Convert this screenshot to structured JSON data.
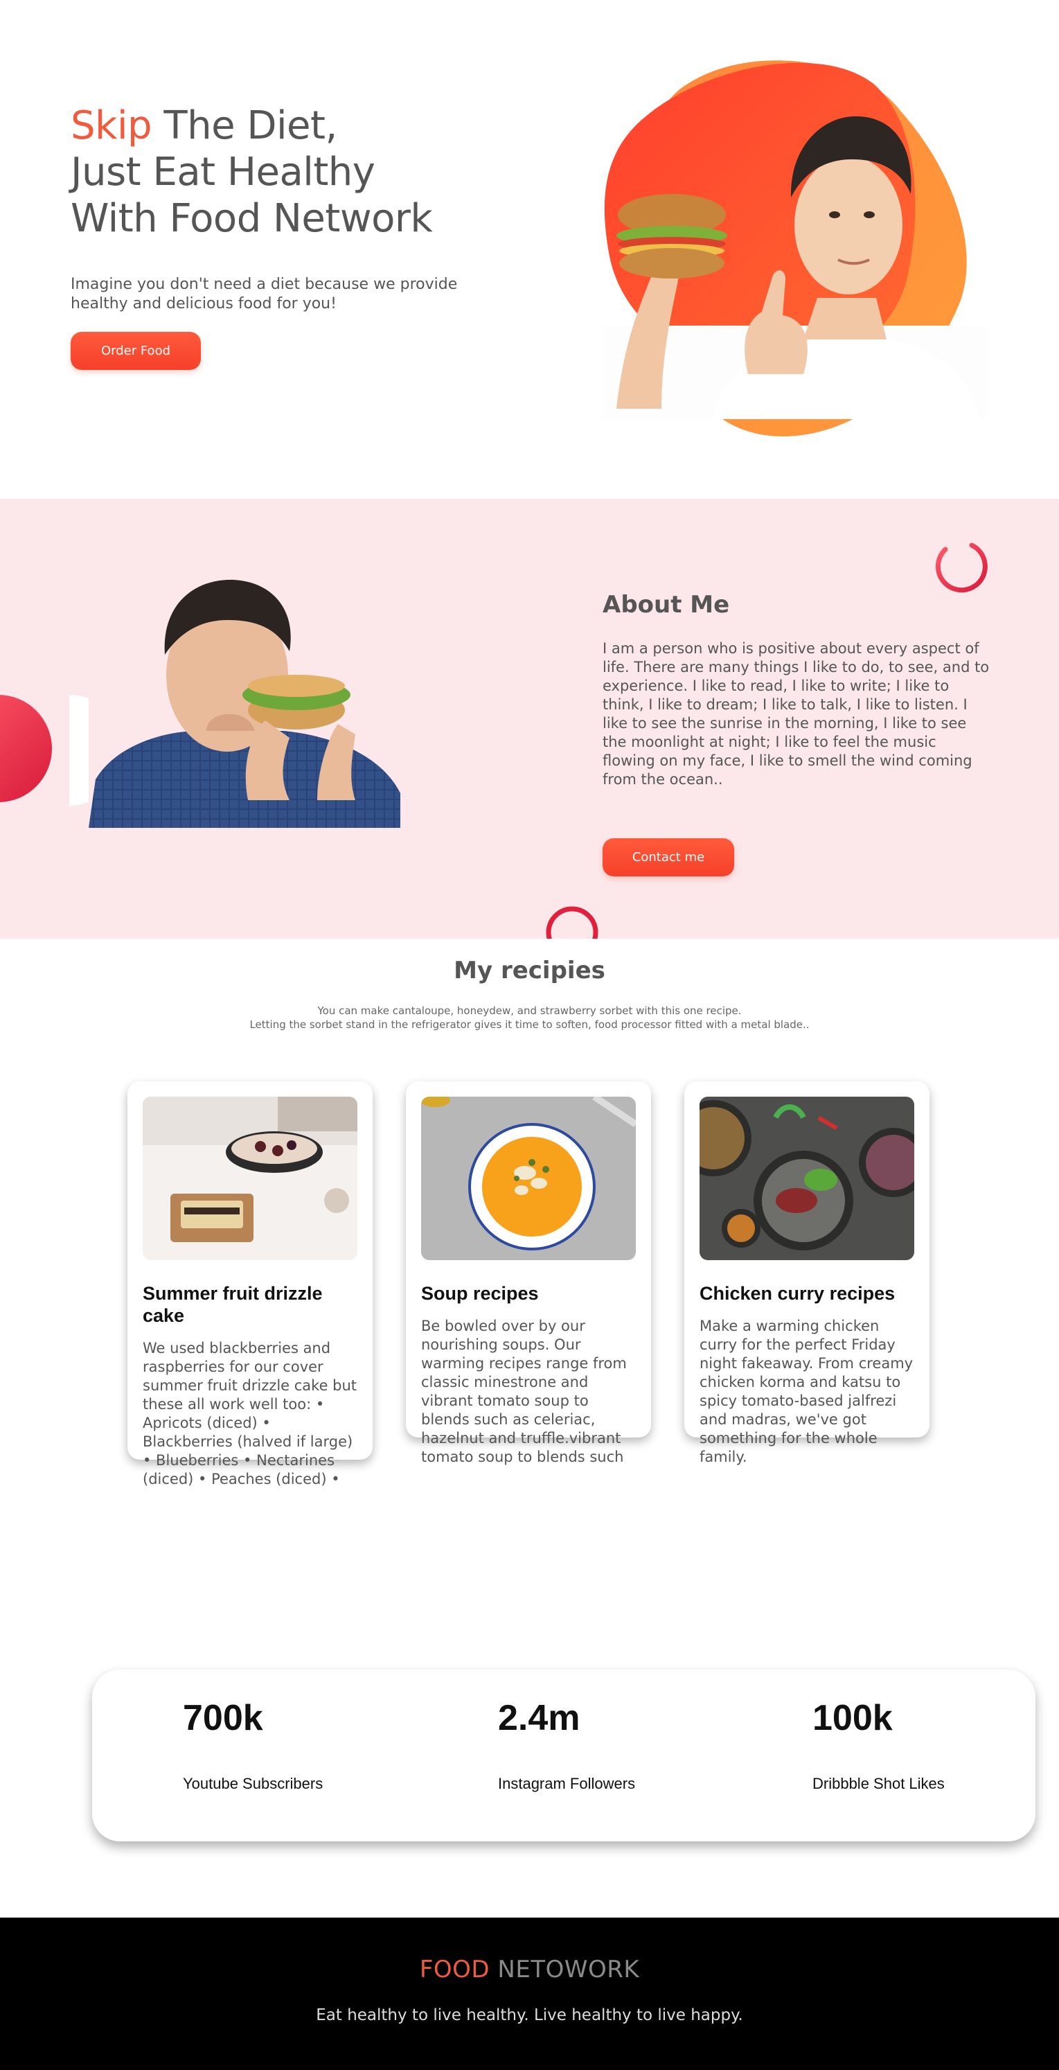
{
  "hero": {
    "title_accent": "Skip",
    "title_line1_rest": " The Diet,",
    "title_line2": "Just Eat Healthy",
    "title_line3": "With Food Network",
    "text": "Imagine you don't need a diet because we provide healthy and delicious food for you!",
    "button_label": "Order Food"
  },
  "about": {
    "title": "About Me",
    "text": "I am a person who is positive about every aspect of life. There are many things I like to do, to see, and to experience. I like to read, I like to write; I like to think, I like to dream; I like to talk, I like to listen. I like to see the sunrise in the morning, I like to see the moonlight at night; I like to feel the music flowing on my face, I like to smell the wind coming from the ocean..",
    "button_label": "Contact me"
  },
  "recipes": {
    "title": "My recipies",
    "subtitle_line1": "You can make cantaloupe, honeydew, and strawberry sorbet with this one recipe.",
    "subtitle_line2": "Letting the sorbet stand in the refrigerator gives it time to soften, food processor fitted with a metal blade..",
    "cards": [
      {
        "title": "Summer fruit drizzle cake",
        "text": "We used blackberries and raspberries for our cover summer fruit drizzle cake but these all work well too: • Apricots (diced) • Blackberries (halved if large) • Blueberries • Nectarines (diced) • Peaches (diced) •"
      },
      {
        "title": "Soup recipes",
        "text": "Be bowled over by our nourishing soups. Our warming recipes range from classic minestrone and vibrant tomato soup to blends such as celeriac, hazelnut and truffle.vibrant tomato soup to blends such"
      },
      {
        "title": "Chicken curry recipes",
        "text": "Make a warming chicken curry for the perfect Friday night fakeaway. From creamy chicken korma and katsu to spicy tomato-based jalfrezi and madras, we've got something for the whole family."
      }
    ]
  },
  "stats": [
    {
      "value": "700k",
      "label": "Youtube Subscribers"
    },
    {
      "value": "2.4m",
      "label": "Instagram Followers"
    },
    {
      "value": "100k",
      "label": "Dribbble Shot Likes"
    }
  ],
  "footer": {
    "brand_part1": "FOOD",
    "brand_part2": " NETOWORK",
    "tagline": "Eat healthy to live healthy. Live healthy to live happy."
  },
  "colors": {
    "accent": "#f15a3b",
    "about_bg": "#fce8ea",
    "footer_bg": "#000000",
    "deco_red": "#e0203c"
  }
}
